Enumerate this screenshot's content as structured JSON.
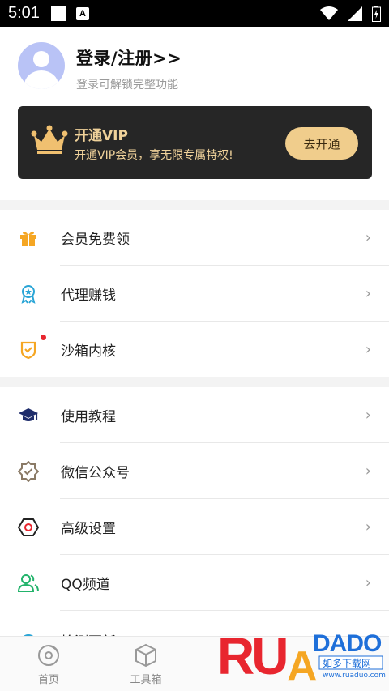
{
  "status_bar": {
    "time": "5:01",
    "notif_letter": "A"
  },
  "profile": {
    "title": "登录/注册>>",
    "subtitle": "登录可解锁完整功能"
  },
  "vip": {
    "title": "开通VIP",
    "subtitle": "开通VIP会员，享无限专属特权!",
    "button": "去开通"
  },
  "menu": {
    "items": [
      {
        "label": "会员免费领",
        "icon": "gift-icon",
        "color": "#f5a623"
      },
      {
        "label": "代理赚钱",
        "icon": "medal-icon",
        "color": "#2aa5d6"
      },
      {
        "label": "沙箱内核",
        "icon": "shield-icon",
        "color": "#f5a623",
        "badge": true
      },
      {
        "label": "使用教程",
        "icon": "graduation-cap-icon",
        "color": "#1f2d6b"
      },
      {
        "label": "微信公众号",
        "icon": "badge-check-icon",
        "color": "#8a7a66"
      },
      {
        "label": "高级设置",
        "icon": "hexagon-settings-icon",
        "color": "#e8262f"
      },
      {
        "label": "QQ频道",
        "icon": "users-icon",
        "color": "#22b36b"
      },
      {
        "label": "检测更新",
        "icon": "refresh-icon",
        "color": "#2aa5d6"
      }
    ],
    "chevron": "›"
  },
  "bottom_nav": {
    "items": [
      {
        "label": "首页",
        "icon": "disc-icon"
      },
      {
        "label": "工具箱",
        "icon": "box-icon"
      }
    ]
  },
  "watermark": {
    "brand": "RUANDADO",
    "sub": "如多下载网",
    "url": "www.ruaduo.com"
  }
}
